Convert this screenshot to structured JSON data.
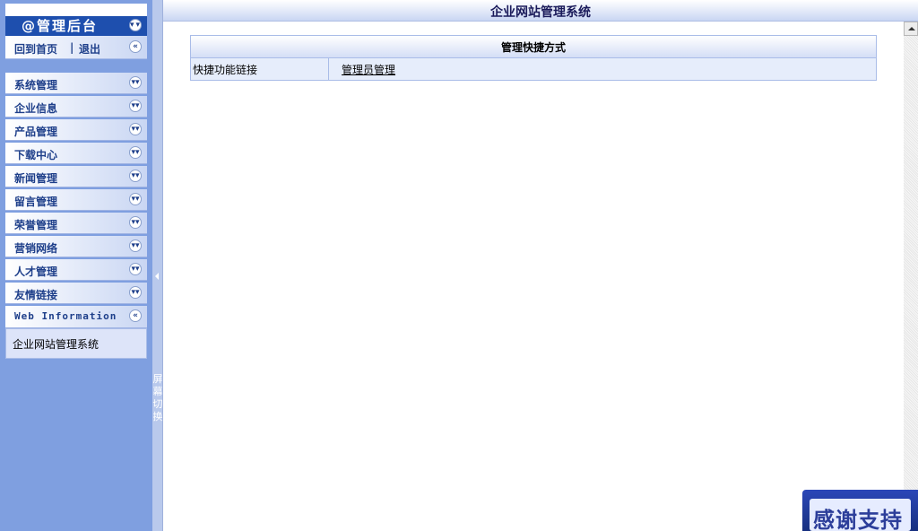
{
  "page_title": "企业网站管理系统",
  "sidebar": {
    "admin_title": "@管理后台",
    "home_link": "回到首页",
    "separator": "|",
    "logout_link": "退出",
    "menu_items": [
      {
        "label": "系统管理",
        "icon": "double-chevron-down-icon"
      },
      {
        "label": "企业信息",
        "icon": "double-chevron-down-icon"
      },
      {
        "label": "产品管理",
        "icon": "double-chevron-down-icon"
      },
      {
        "label": "下载中心",
        "icon": "double-chevron-down-icon"
      },
      {
        "label": "新闻管理",
        "icon": "double-chevron-down-icon"
      },
      {
        "label": "留言管理",
        "icon": "double-chevron-down-icon"
      },
      {
        "label": "荣誉管理",
        "icon": "double-chevron-down-icon"
      },
      {
        "label": "营销网络",
        "icon": "double-chevron-down-icon"
      },
      {
        "label": "人才管理",
        "icon": "double-chevron-down-icon"
      },
      {
        "label": "友情链接",
        "icon": "double-chevron-down-icon"
      }
    ],
    "web_info": {
      "label": "Web Information",
      "content": "企业网站管理系统"
    }
  },
  "splitter": {
    "text": "屏幕切换"
  },
  "main": {
    "shortcut_table": {
      "title": "管理快捷方式",
      "row_label": "快捷功能链接",
      "row_link": "管理员管理"
    }
  },
  "badge": {
    "text": "感谢支持"
  },
  "colors": {
    "sidebar_bg": "#7f9fe0",
    "title_bar": "#1e4fae",
    "menu_text": "#1e3f8a"
  }
}
